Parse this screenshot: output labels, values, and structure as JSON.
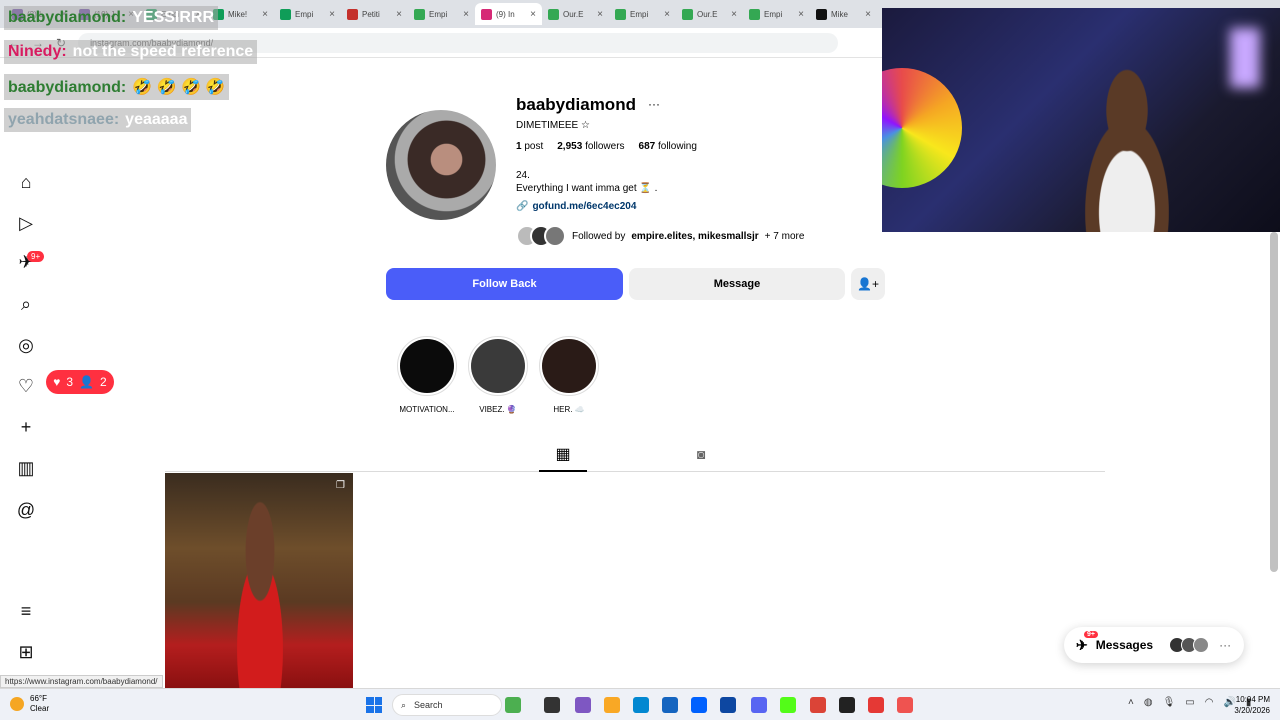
{
  "browser": {
    "tabs": [
      {
        "label": "(2) L",
        "color": "#6441a5"
      },
      {
        "label": "(10) J",
        "color": "#6441a5"
      },
      {
        "label": "Empi",
        "color": "#0f9d58"
      },
      {
        "label": "Mike!",
        "color": "#0f9d58"
      },
      {
        "label": "Empi",
        "color": "#0f9d58"
      },
      {
        "label": "Petiti",
        "color": "#c4302b"
      },
      {
        "label": "Empi",
        "color": "#34a853"
      },
      {
        "label": "(9) In",
        "color": "#d62976",
        "active": true
      },
      {
        "label": "Our.E",
        "color": "#34a853"
      },
      {
        "label": "Empi",
        "color": "#34a853"
      },
      {
        "label": "Our.E",
        "color": "#34a853"
      },
      {
        "label": "Empi",
        "color": "#34a853"
      },
      {
        "label": "Mike",
        "color": "#111111"
      }
    ],
    "url": "instagram.com/baabydiamond/",
    "status_url": "https://www.instagram.com/baabydiamond/"
  },
  "chat": [
    {
      "user": "baabydiamond:",
      "user_color": "#2e7d32",
      "msg": "YESSIRRR",
      "msg_color": "#ffffff"
    },
    {
      "user": "Ninedy:",
      "user_color": "#d81b60",
      "msg": "not the speed reference",
      "msg_color": "#ffffff"
    },
    {
      "user": "baabydiamond:",
      "user_color": "#2e7d32",
      "msg": "🤣 🤣 🤣 🤣",
      "msg_color": "#ffffff"
    },
    {
      "user": "yeahdatsnaee:",
      "user_color": "#90a4ae",
      "msg": "yeaaaaa",
      "msg_color": "#ffffff"
    }
  ],
  "nav": {
    "notif_badge": "9+",
    "likes_count": "3",
    "follows_count": "2"
  },
  "profile": {
    "username": "baabydiamond",
    "more": "···",
    "full_name": "DIMETIMEEE ☆",
    "posts_num": "1",
    "posts_label": "post",
    "followers_num": "2,953",
    "followers_label": "followers",
    "following_num": "687",
    "following_label": "following",
    "bio_line1": "24.",
    "bio_line2": "Everything I want imma get ⏳ .",
    "link": "gofund.me/6ec4ec204",
    "followed_by_prefix": "Followed by",
    "followed_by_names": "empire.elites, mikesmallsjr",
    "followed_by_more": "+ 7 more"
  },
  "buttons": {
    "follow_back": "Follow Back",
    "message": "Message"
  },
  "highlights": [
    {
      "label": "MOTIVATION...",
      "color": "#0b0b0b"
    },
    {
      "label": "VIBEZ. 🔮",
      "color": "#3a3a3a"
    },
    {
      "label": "HER. ☁️",
      "color": "#2a1b17"
    }
  ],
  "messages_pill": {
    "label": "Messages",
    "badge": "9+",
    "more": "···"
  },
  "taskbar": {
    "temp": "66°F",
    "cond": "Clear",
    "search": "Search",
    "time": "10:04 PM",
    "date": "3/20/2026"
  }
}
